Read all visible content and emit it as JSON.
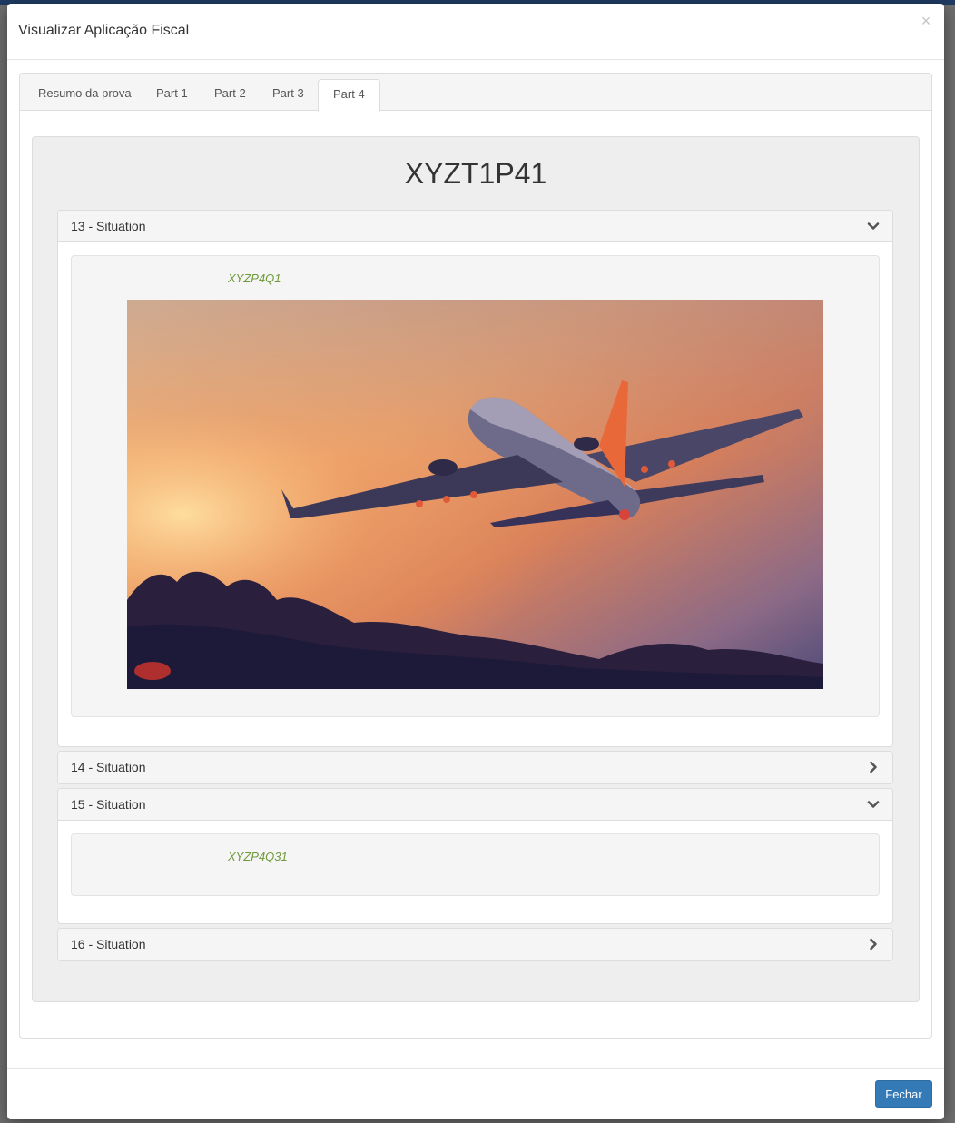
{
  "modal": {
    "title": "Visualizar Aplicação Fiscal",
    "close_label": "×"
  },
  "tabs": [
    {
      "label": "Resumo da prova",
      "active": false
    },
    {
      "label": "Part 1",
      "active": false
    },
    {
      "label": "Part 2",
      "active": false
    },
    {
      "label": "Part 3",
      "active": false
    },
    {
      "label": "Part 4",
      "active": true
    }
  ],
  "exam": {
    "code": "XYZT1P41"
  },
  "questions": [
    {
      "label": "13 - Situation",
      "expanded": true,
      "question_code": "XYZP4Q1",
      "has_image": true,
      "image_alt": "airplane-sunset-photo"
    },
    {
      "label": "14 - Situation",
      "expanded": false
    },
    {
      "label": "15 - Situation",
      "expanded": true,
      "question_code": "XYZP4Q31",
      "has_image": false
    },
    {
      "label": "16 - Situation",
      "expanded": false
    }
  ],
  "footer": {
    "close_button": "Fechar"
  },
  "colors": {
    "primary": "#337ab7",
    "question_code": "#6f9a3a"
  }
}
